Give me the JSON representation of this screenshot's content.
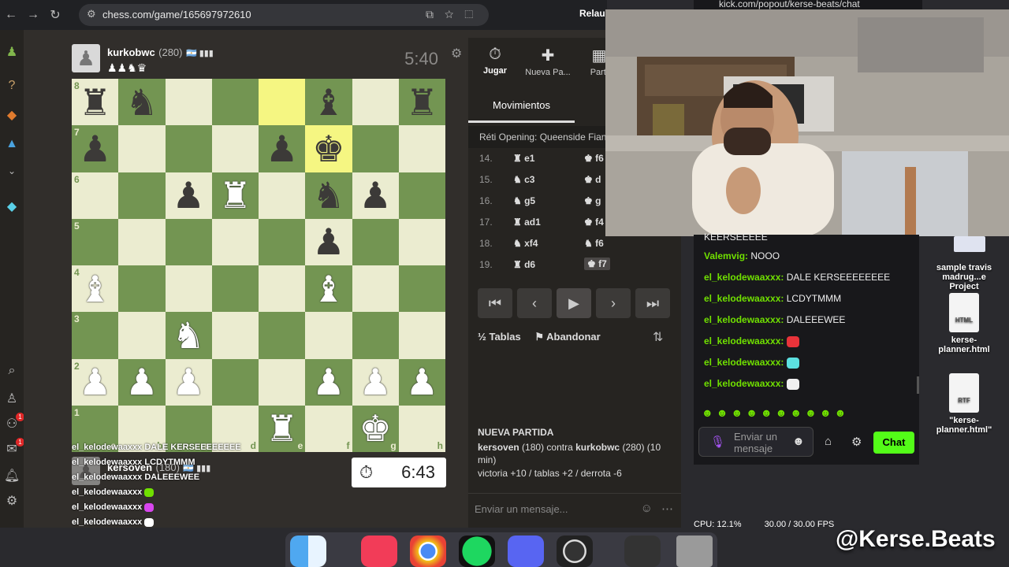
{
  "browser": {
    "url": "chess.com/game/165697972610",
    "relaunch": "Relau"
  },
  "kick_url": "kick.com/popout/kerse-beats/chat",
  "top_player": {
    "name": "kurkobwc",
    "rating": "(280)",
    "flag": "🇦🇷 ▮▮▮",
    "captured": "♟♟♞♛",
    "clock": "5:40"
  },
  "bottom_player": {
    "name": "kersoven",
    "rating": "(180)",
    "flag": "🇦🇷 ▮▮▮",
    "clock": "6:43"
  },
  "board": {
    "highlight": [
      "e8",
      "f7"
    ],
    "pieces": {
      "a8": "bR",
      "b8": "bN",
      "f8": "bB",
      "h8": "bR",
      "a7": "bP",
      "e7": "bP",
      "f7": "bK",
      "c6": "bP",
      "d6": "wR",
      "f6": "bN",
      "g6": "bP",
      "f5": "bP",
      "a4": "wB",
      "f4": "wB",
      "c3": "wN",
      "a2": "wP",
      "b2": "wP",
      "c2": "wP",
      "f2": "wP",
      "g2": "wP",
      "h2": "wP",
      "e1": "wR",
      "g1": "wK"
    },
    "ranks": [
      "8",
      "7",
      "6",
      "5",
      "4",
      "3",
      "2",
      "1"
    ],
    "files": [
      "a",
      "b",
      "c",
      "d",
      "e",
      "f",
      "g",
      "h"
    ]
  },
  "panel": {
    "tabs": [
      {
        "label": "Jugar",
        "icon": "⏱"
      },
      {
        "label": "Nueva Pa...",
        "icon": "✚"
      },
      {
        "label": "Parti",
        "icon": "▦"
      }
    ],
    "moves_tab": "Movimientos",
    "opening": "Réti Opening: Queenside Fian",
    "moves": [
      {
        "n": "14.",
        "w": "♜ e1",
        "b": "♚ f6"
      },
      {
        "n": "15.",
        "w": "♞ c3",
        "b": "♚ d"
      },
      {
        "n": "16.",
        "w": "♞ g5",
        "b": "♚ g"
      },
      {
        "n": "17.",
        "w": "♜ ad1",
        "b": "♚ f4"
      },
      {
        "n": "18.",
        "w": "♞ xf4",
        "b": "♞ f6"
      },
      {
        "n": "19.",
        "w": "♜ d6",
        "b": "♚ f7"
      }
    ],
    "draw": "Tablas",
    "resign": "Abandonar",
    "new_game_title": "NUEVA PARTIDA",
    "new_game_p1": "kersoven",
    "new_game_r1": "(180) contra",
    "new_game_p2": "kurkobwc",
    "new_game_r2": "(280) (10 min)",
    "new_game_score": "victoria +10 / tablas +2 / derrota -6",
    "message_placeholder": "Enviar un mensaje..."
  },
  "chat": {
    "top_partial": "KEERSEEEEE",
    "lines": [
      {
        "user": "Valemvig:",
        "text": "NOOO"
      },
      {
        "user": "el_kelodewaaxxx:",
        "text": "DALE KERSEEEEEEEE"
      },
      {
        "user": "el_kelodewaaxxx:",
        "text": "LCDYTMMM"
      },
      {
        "user": "el_kelodewaaxxx:",
        "text": "DALEEEWEE"
      },
      {
        "user": "el_kelodewaaxxx:",
        "text": "",
        "emote": "#e8333a"
      },
      {
        "user": "el_kelodewaaxxx:",
        "text": "",
        "emote": "#5ce0e0"
      },
      {
        "user": "el_kelodewaaxxx:",
        "text": "",
        "emote": "#f0f0f0"
      }
    ],
    "input_placeholder": "Enviar un mensaje",
    "send": "Chat"
  },
  "overlay": [
    {
      "user": "el_kelodewaaxxx",
      "text": "DALE KERSEEEEEEEE"
    },
    {
      "user": "el_kelodewaaxxx",
      "text": "LCDYTMMM"
    },
    {
      "user": "el_kelodewaaxxx",
      "text": "DALEEEWEE"
    },
    {
      "user": "el_kelodewaaxxx",
      "text": ""
    },
    {
      "user": "el_kelodewaaxxx",
      "text": ""
    },
    {
      "user": "el_kelodewaaxxx",
      "text": ""
    }
  ],
  "desktop": [
    {
      "label": "sample travis madrug...e Project",
      "type": ""
    },
    {
      "label": "kerse-planner.html",
      "type": "HTML"
    },
    {
      "label": "\"kerse-planner.html\"",
      "type": "RTF"
    }
  ],
  "stats": {
    "cpu": "CPU: 12.1%",
    "fps": "30.00 / 30.00 FPS"
  },
  "handle": "@Kerse.Beats"
}
